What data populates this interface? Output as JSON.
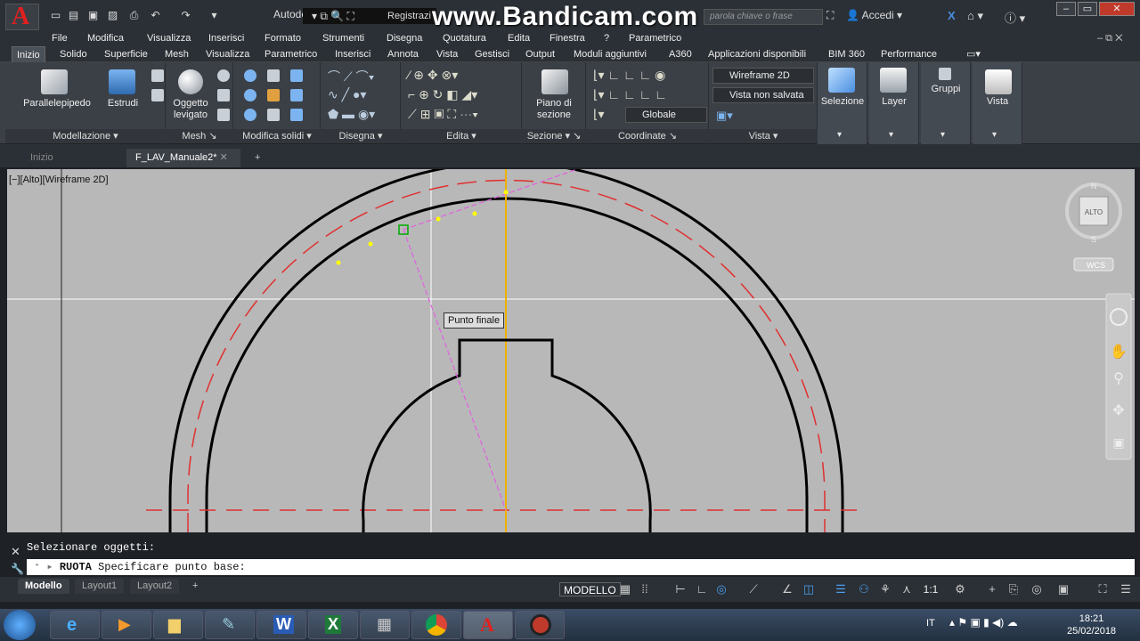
{
  "titlebar": {
    "app_name": "Autode",
    "registration": "Registrazi",
    "watermark": "www.Bandicam.com",
    "search_placeholder": "parola chiave o frase",
    "signin": "Accedi"
  },
  "menu": [
    "File",
    "Modifica",
    "Visualizza",
    "Inserisci",
    "Formato",
    "Strumenti",
    "Disegna",
    "Quotatura",
    "Edita",
    "Finestra",
    "?",
    "Parametrico"
  ],
  "ribbon_tabs": [
    "Inizio",
    "Solido",
    "Superficie",
    "Mesh",
    "Visualizza",
    "Parametrico",
    "Inserisci",
    "Annota",
    "Vista",
    "Gestisci",
    "Output",
    "Moduli aggiuntivi",
    "A360",
    "Applicazioni disponibili",
    "BIM 360",
    "Performance"
  ],
  "ribbon": {
    "parallelepipedo": "Parallelepipedo",
    "estrudi": "Estrudi",
    "oggetto_levigato_1": "Oggetto",
    "oggetto_levigato_2": "levigato",
    "piano_1": "Piano di",
    "piano_2": "sezione",
    "visual_style": "Wireframe 2D",
    "view_state": "Vista non salvata",
    "ucs": "Globale",
    "selezione": "Selezione",
    "layer": "Layer",
    "gruppi": "Gruppi",
    "vista": "Vista",
    "panels": {
      "modellazione": "Modellazione",
      "mesh": "Mesh",
      "modifica_solidi": "Modifica solidi",
      "disegna": "Disegna",
      "edita": "Edita",
      "sezione": "Sezione",
      "coordinate": "Coordinate",
      "vista": "Vista"
    }
  },
  "doc_tabs": [
    "Inizio",
    "F_LAV_Manuale2*"
  ],
  "viewport": {
    "label": "[−][Alto][Wireframe 2D]",
    "tooltip": "Punto finale",
    "viewcube_face": "ALTO",
    "compass_n": "N",
    "compass_s": "S",
    "wcs": "WCS"
  },
  "command": {
    "history": "Selezionare oggetti:",
    "prompt_cmd": "RUOTA",
    "prompt_text": "Specificare punto base:"
  },
  "layout_tabs": [
    "Modello",
    "Layout1",
    "Layout2"
  ],
  "status": {
    "space": "MODELLO",
    "scale": "1:1"
  },
  "taskbar": {
    "lang": "IT",
    "time": "18:21",
    "date": "25/02/2018"
  },
  "colors": {
    "accent_red": "#e02020",
    "background_viewport": "#b8b8b8",
    "center_line": "#e03030",
    "ortho_axis": "#f0b000",
    "rubber_band": "#e060e0"
  }
}
